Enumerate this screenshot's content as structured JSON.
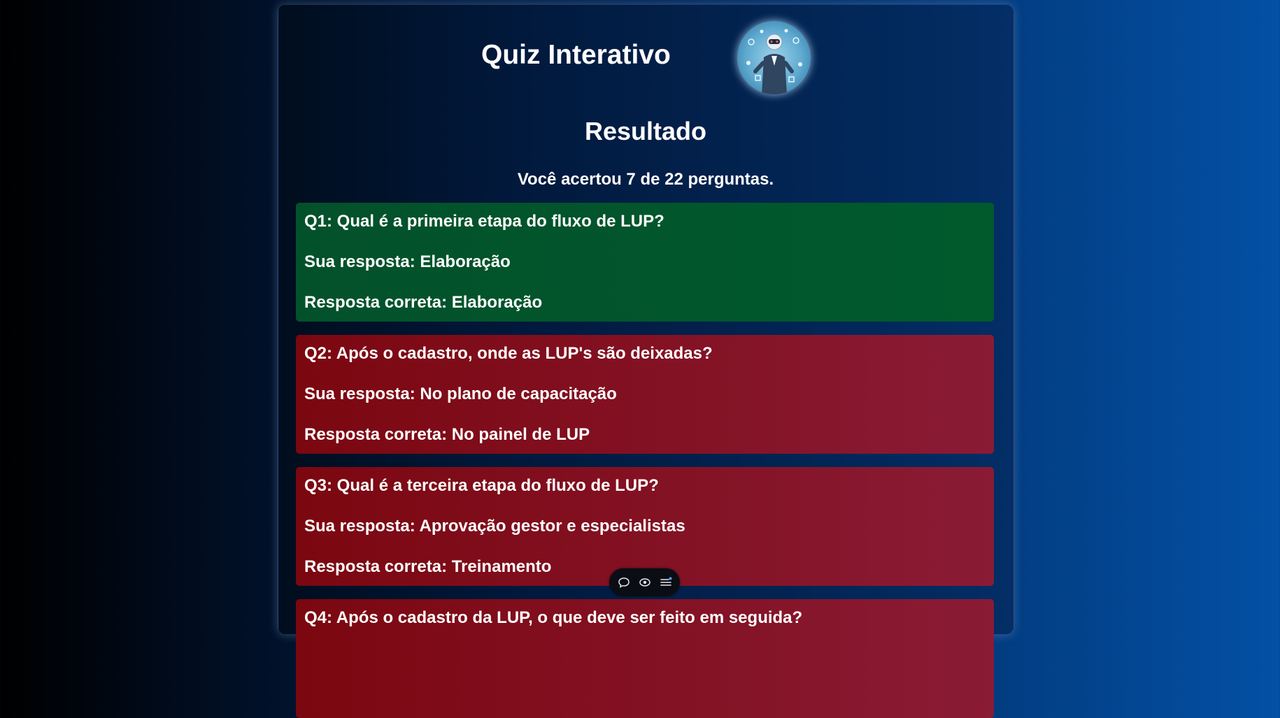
{
  "header": {
    "title": "Quiz Interativo"
  },
  "result": {
    "title": "Resultado",
    "score_text": "Você acertou 7 de 22 perguntas."
  },
  "questions": [
    {
      "question": "Q1: Qual é a primeira etapa do fluxo de LUP?",
      "your_answer": "Sua resposta: Elaboração",
      "correct_answer": "Resposta correta: Elaboração",
      "status": "correct"
    },
    {
      "question": "Q2: Após o cadastro, onde as LUP's são deixadas?",
      "your_answer": "Sua resposta: No plano de capacitação",
      "correct_answer": "Resposta correta: No painel de LUP",
      "status": "wrong"
    },
    {
      "question": "Q3: Qual é a terceira etapa do fluxo de LUP?",
      "your_answer": "Sua resposta: Aprovação gestor e especialistas",
      "correct_answer": "Resposta correta: Treinamento",
      "status": "wrong"
    },
    {
      "question": "Q4: Após o cadastro da LUP, o que deve ser feito em seguida?",
      "status": "wrong"
    }
  ],
  "toolbar": {
    "icons": [
      "chat-icon",
      "eye-icon",
      "menu-icon"
    ]
  },
  "colors": {
    "correct": "#005a2c",
    "wrong": "#8a1b35",
    "toolbar_dot": "#4ea3ff"
  }
}
